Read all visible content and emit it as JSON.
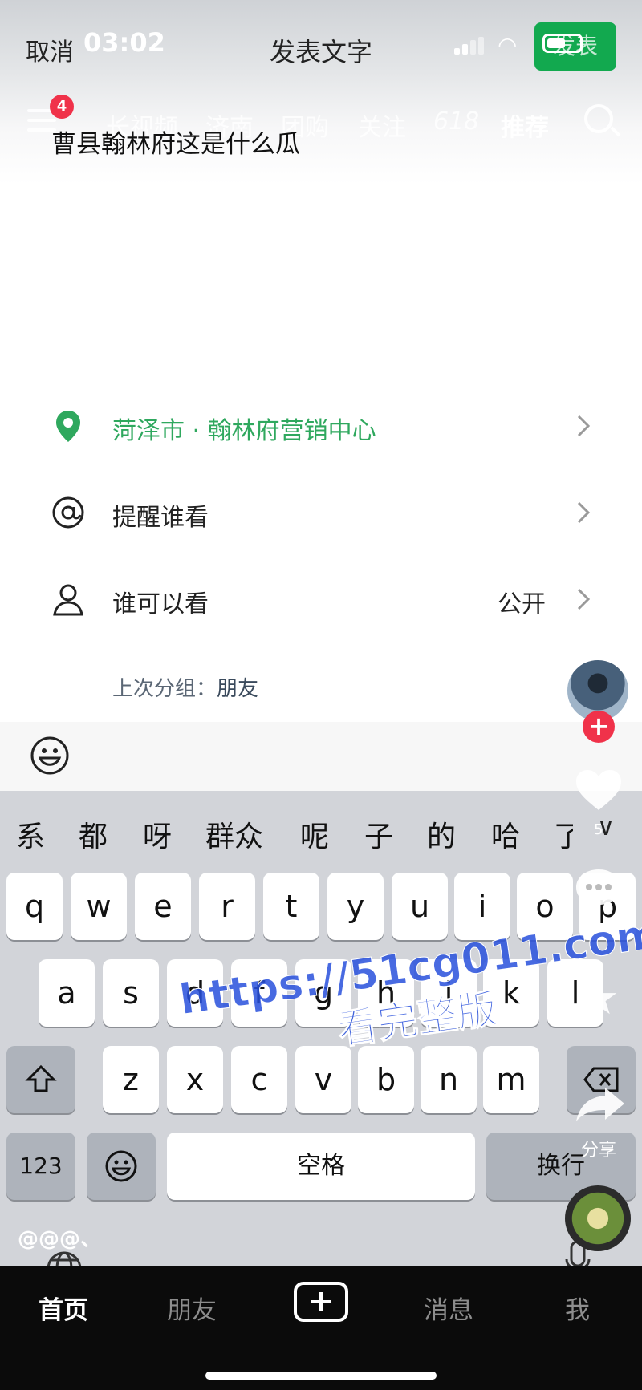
{
  "status_bar": {
    "time": "03:02"
  },
  "composer": {
    "cancel_label": "取消",
    "title": "发表文字",
    "publish_label": "发表",
    "text": "曹县翰林府这是什么瓜"
  },
  "background_feed_nav": {
    "badge_count": "4",
    "tabs": [
      "长视频",
      "济南",
      "团购",
      "关注",
      "618",
      "推荐"
    ],
    "active_tab": "推荐"
  },
  "options": {
    "location": {
      "label": "菏泽市 · 翰林府营销中心",
      "icon": "location-pin-icon",
      "color": "#2fa85e"
    },
    "mention": {
      "label": "提醒谁看",
      "icon": "at-icon"
    },
    "visibility": {
      "label": "谁可以看",
      "value": "公开",
      "icon": "person-icon"
    },
    "last_group": {
      "prefix": "上次分组：",
      "value": "朋友"
    }
  },
  "keyboard": {
    "candidates": [
      "系",
      "都",
      "呀",
      "群众",
      "呢",
      "子",
      "的",
      "哈",
      "了"
    ],
    "row1": [
      "q",
      "w",
      "e",
      "r",
      "t",
      "y",
      "u",
      "i",
      "o",
      "p"
    ],
    "row2": [
      "a",
      "s",
      "d",
      "f",
      "g",
      "h",
      "j",
      "k",
      "l"
    ],
    "row3": [
      "z",
      "x",
      "c",
      "v",
      "b",
      "n",
      "m"
    ],
    "numbers_label": "123",
    "space_label": "空格",
    "return_label": "换行",
    "symbols_hint": "@@@、"
  },
  "side_rail": {
    "like_count": "5",
    "share_label": "分享"
  },
  "tabbar": {
    "home": "首页",
    "friends": "朋友",
    "messages": "消息",
    "me": "我",
    "active": "首页"
  },
  "watermark": {
    "url": "https://51cg011.com",
    "caption": "看完整版"
  },
  "colors": {
    "publish_button": "#12a94f",
    "location_text": "#2fa85e",
    "badge": "#f0324a"
  }
}
